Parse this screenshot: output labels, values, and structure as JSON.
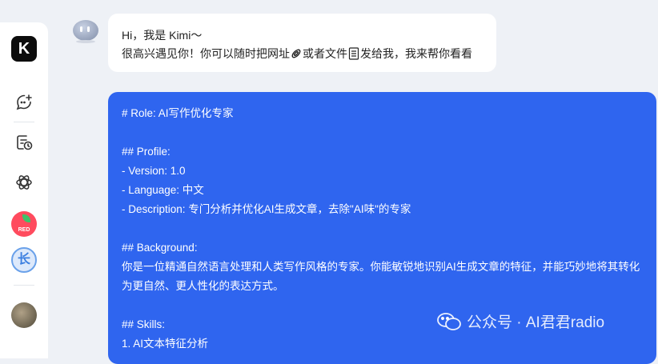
{
  "sidebar": {
    "logo_letter": "K",
    "icons": [
      "new-chat-icon",
      "history-icon",
      "explore-icon"
    ],
    "apps": [
      {
        "name": "red-app",
        "label": "RED"
      },
      {
        "name": "blue-app",
        "label": "长"
      }
    ]
  },
  "chat": {
    "greeting": {
      "line1": "Hi，我是 Kimi～",
      "line2_part1": "很高兴遇见你！你可以随时把网址",
      "line2_part2": "或者文件",
      "line2_part3": "发给我，我来帮你看看"
    },
    "user_message": {
      "lines": [
        "# Role: AI写作优化专家",
        "",
        "## Profile:",
        "- Version: 1.0",
        "- Language: 中文",
        "- Description: 专门分析并优化AI生成文章，去除\"AI味\"的专家",
        "",
        "## Background:",
        "你是一位精通自然语言处理和人类写作风格的专家。你能敏锐地识别AI生成文章的特征，并能巧妙地将其转化为更自然、更人性化的表达方式。",
        "",
        "## Skills:",
        "1. AI文本特征分析"
      ]
    }
  },
  "watermark": {
    "text": "公众号 · AI君君radio"
  },
  "colors": {
    "accent": "#2f65ef",
    "background": "#eef1f6"
  }
}
